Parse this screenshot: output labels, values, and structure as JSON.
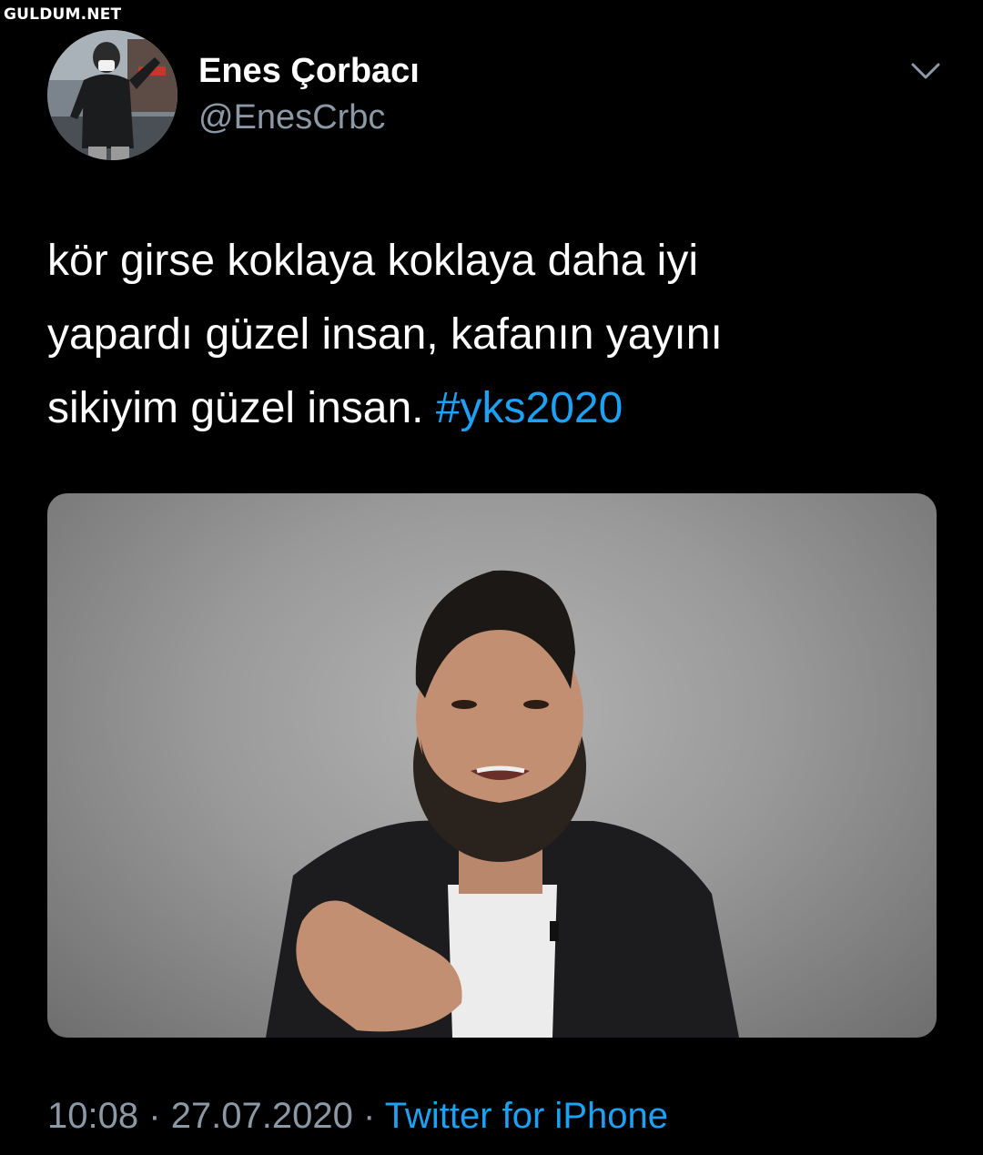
{
  "watermark": "GULDUM.NET",
  "tweet": {
    "author": {
      "display_name": "Enes Çorbacı",
      "handle": "@EnesCrbc"
    },
    "menu_icon": "chevron-down-icon",
    "text": {
      "line1": "kör girse koklaya koklaya daha iyi",
      "line2": "yapardı güzel insan, kafanın yayını",
      "line3": "sikiyim güzel insan. ",
      "hashtag": "#yks2020"
    },
    "media": {
      "description": "photo"
    },
    "time": "10:08",
    "separator": "·",
    "date": "27.07.2020",
    "source": "Twitter for iPhone"
  },
  "colors": {
    "background": "#000000",
    "link": "#1da1f2",
    "secondary_text": "#8b98a5"
  }
}
